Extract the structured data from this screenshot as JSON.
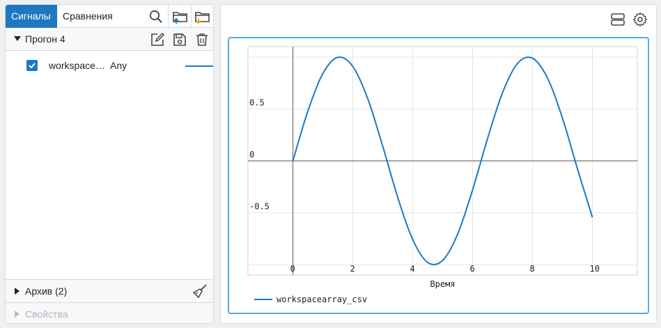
{
  "tabs": {
    "signals": "Сигналы",
    "comparisons": "Сравнения"
  },
  "toolbar_icons": [
    "search-icon",
    "folder-upload-icon",
    "folder-download-icon"
  ],
  "run": {
    "label": "Прогон 4",
    "icons": [
      "edit-icon",
      "save-icon",
      "trash-icon"
    ]
  },
  "signal": {
    "name": "workspace…",
    "type": "Any",
    "checked": true,
    "color": "#1d78c1"
  },
  "archive": {
    "label": "Архив (2)"
  },
  "properties": {
    "label": "Свойства"
  },
  "right_icons": [
    "layout-icon",
    "gear-icon"
  ],
  "chart_data": {
    "type": "line",
    "xlabel": "Время",
    "x_ticks": [
      "0",
      "2",
      "4",
      "6",
      "8",
      "10"
    ],
    "y_ticks": [
      "0.5",
      "0",
      "-0.5"
    ],
    "xlim": [
      -1.5,
      11.5
    ],
    "ylim": [
      -1.1,
      1.1
    ],
    "grid": true,
    "legend": "bottom-left",
    "series": [
      {
        "name": "workspacearray_csv",
        "color": "#1d78c1",
        "x": [
          0,
          0.5,
          1,
          1.5,
          2,
          2.5,
          3,
          3.5,
          4,
          4.5,
          5,
          5.5,
          6,
          6.5,
          7,
          7.5,
          8,
          8.5,
          9,
          9.5,
          10
        ],
        "y": [
          0,
          0.479,
          0.841,
          0.997,
          0.909,
          0.598,
          0.141,
          -0.351,
          -0.757,
          -0.978,
          -0.959,
          -0.706,
          -0.279,
          0.215,
          0.657,
          0.938,
          0.989,
          0.798,
          0.412,
          -0.075,
          -0.544
        ]
      }
    ]
  }
}
